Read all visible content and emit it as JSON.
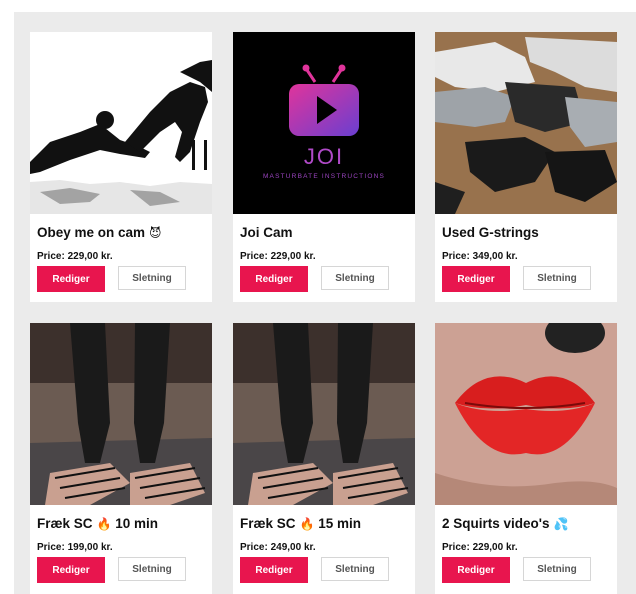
{
  "products": [
    {
      "title": "Obey me on cam",
      "emoji": "😈",
      "price_label": "Price:",
      "price": "229,00 kr.",
      "edit_label": "Rediger",
      "delete_label": "Sletning",
      "thumb": "silhouette-art"
    },
    {
      "title": "Joi Cam",
      "emoji": "",
      "price_label": "Price:",
      "price": "229,00 kr.",
      "edit_label": "Rediger",
      "delete_label": "Sletning",
      "thumb": "joi-logo"
    },
    {
      "title": "Used G-strings",
      "emoji": "",
      "price_label": "Price:",
      "price": "349,00 kr.",
      "edit_label": "Rediger",
      "delete_label": "Sletning",
      "thumb": "underwear-photo"
    },
    {
      "title": "Fræk SC",
      "emoji": "🔥",
      "suffix": "10 min",
      "price_label": "Price:",
      "price": "199,00 kr.",
      "edit_label": "Rediger",
      "delete_label": "Sletning",
      "thumb": "stockings-photo"
    },
    {
      "title": "Fræk SC",
      "emoji": "🔥",
      "suffix": "15 min",
      "price_label": "Price:",
      "price": "249,00 kr.",
      "edit_label": "Rediger",
      "delete_label": "Sletning",
      "thumb": "stockings-photo"
    },
    {
      "title": "2 Squirts video's",
      "emoji": "💦",
      "price_label": "Price:",
      "price": "229,00 kr.",
      "edit_label": "Rediger",
      "delete_label": "Sletning",
      "thumb": "lips-photo"
    }
  ],
  "joi_logo": {
    "brand": "JOI",
    "tagline": "MASTURBATE INSTRUCTIONS"
  },
  "colors": {
    "accent": "#e8154e",
    "background": "#ebebeb",
    "card": "#ffffff"
  }
}
